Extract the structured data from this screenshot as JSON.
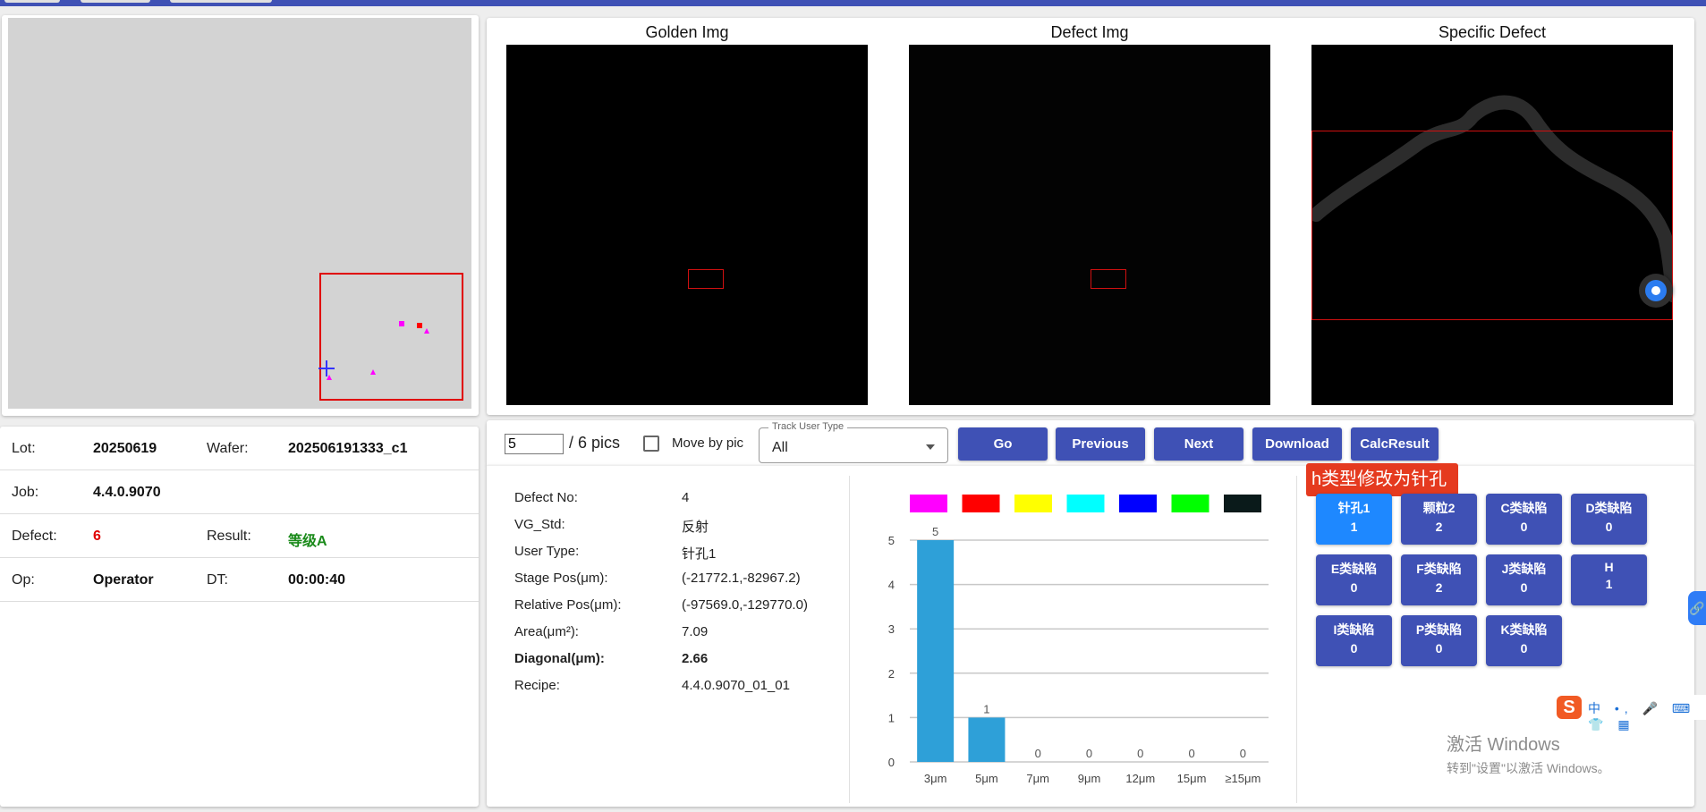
{
  "map": {
    "zoom_box_color": "#e00000"
  },
  "info": {
    "lot_label": "Lot:",
    "lot_value": "20250619",
    "wafer_label": "Wafer:",
    "wafer_value": "202506191333_c1",
    "job_label": "Job:",
    "job_value": "4.4.0.9070",
    "defect_label": "Defect:",
    "defect_value": "6",
    "result_label": "Result:",
    "result_value": "等级A",
    "op_label": "Op:",
    "op_value": "Operator",
    "dt_label": "DT:",
    "dt_value": "00:00:40"
  },
  "images": {
    "golden_title": "Golden Img",
    "defect_title": "Defect Img",
    "specific_title": "Specific Defect"
  },
  "controls": {
    "pic_index": "5",
    "pic_total": "/ 6 pics",
    "move_by_pic_label": "Move by pic",
    "track_user_type_label": "Track User Type",
    "track_user_type_value": "All",
    "go_label": "Go",
    "previous_label": "Previous",
    "next_label": "Next",
    "download_label": "Download",
    "calcresult_label": "CalcResult"
  },
  "details": [
    {
      "label": "Defect No:",
      "value": "4",
      "bold": false
    },
    {
      "label": "VG_Std:",
      "value": "反射",
      "bold": false
    },
    {
      "label": "User Type:",
      "value": "针孔1",
      "bold": false
    },
    {
      "label": "Stage Pos(μm):",
      "value": "(-21772.1,-82967.2)",
      "bold": false
    },
    {
      "label": "Relative Pos(μm):",
      "value": "(-97569.0,-129770.0)",
      "bold": false
    },
    {
      "label": "Area(μm²):",
      "value": "7.09",
      "bold": false
    },
    {
      "label": "Diagonal(μm):",
      "value": "2.66",
      "bold": true
    },
    {
      "label": "Recipe:",
      "value": "4.4.0.9070_01_01",
      "bold": false
    }
  ],
  "chart_data": {
    "type": "bar",
    "categories": [
      "3μm",
      "5μm",
      "7μm",
      "9μm",
      "12μm",
      "15μm",
      "≥15μm"
    ],
    "values": [
      5,
      1,
      0,
      0,
      0,
      0,
      0
    ],
    "ylim": [
      0,
      5
    ],
    "yticks": [
      "0",
      "1",
      "2",
      "3",
      "4",
      "5"
    ],
    "bar_color": "#2ea0d8",
    "legend_colors": [
      "#ff00ff",
      "#ff0000",
      "#ffff00",
      "#00ffff",
      "#0000ff",
      "#00ff00",
      "#0a1a1a"
    ],
    "grid": true
  },
  "tooltip": "h类型修改为针孔",
  "type_buttons": [
    {
      "name": "针孔1",
      "count": "1",
      "active": true
    },
    {
      "name": "颗粒2",
      "count": "2",
      "active": false
    },
    {
      "name": "C类缺陷",
      "count": "0",
      "active": false
    },
    {
      "name": "D类缺陷",
      "count": "0",
      "active": false
    },
    {
      "name": "E类缺陷",
      "count": "0",
      "active": false
    },
    {
      "name": "F类缺陷",
      "count": "2",
      "active": false
    },
    {
      "name": "J类缺陷",
      "count": "0",
      "active": false
    },
    {
      "name": "H",
      "count": "1",
      "active": false
    },
    {
      "name": "I类缺陷",
      "count": "0",
      "active": false
    },
    {
      "name": "P类缺陷",
      "count": "0",
      "active": false
    },
    {
      "name": "K类缺陷",
      "count": "0",
      "active": false
    }
  ],
  "system": {
    "ime_logo": "S",
    "ime_items": "中 •, 🎤 ⌨ 👕 ▦",
    "watermark_title": "激活 Windows",
    "watermark_sub": "转到\"设置\"以激活 Windows。"
  },
  "colors": {
    "primary": "#3f51b5",
    "active_type": "#1e88ff",
    "defect_count": "#e00000",
    "result": "#1a8a1a",
    "tooltip": "#e53a1f"
  }
}
